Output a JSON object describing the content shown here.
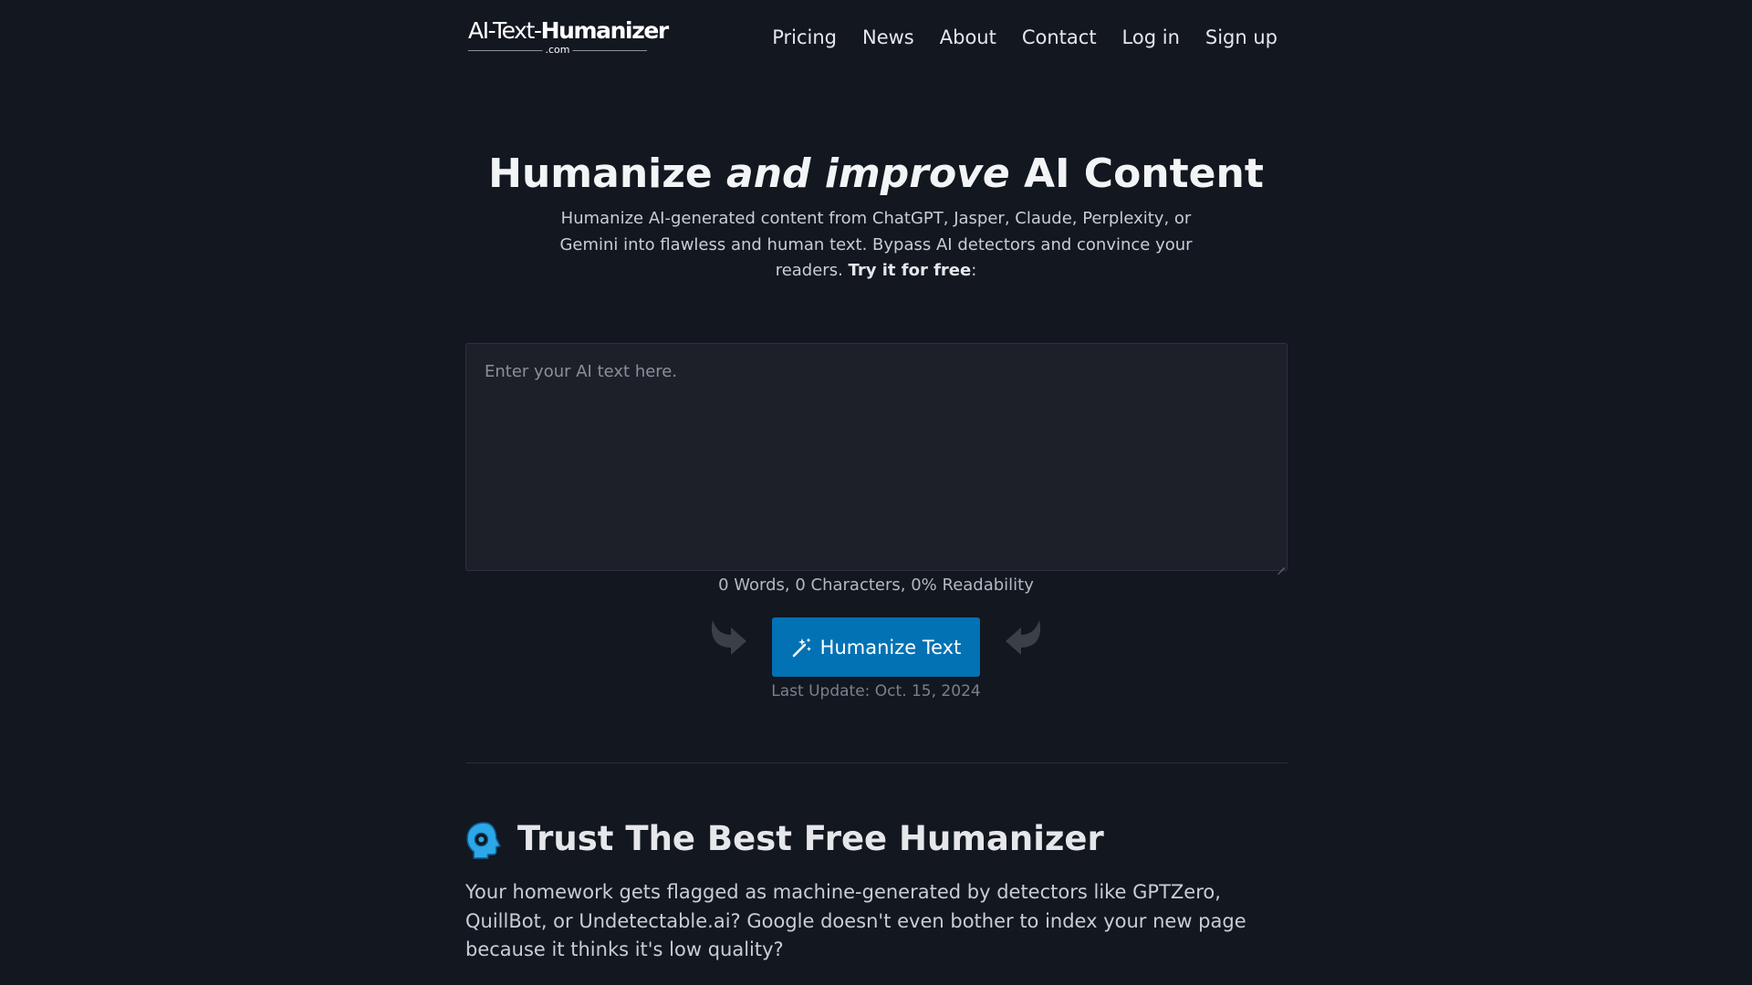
{
  "header": {
    "logo": {
      "part1": "AI-Text-",
      "part2": "Humanizer",
      "sub": ".com"
    },
    "nav": [
      "Pricing",
      "News",
      "About",
      "Contact",
      "Log in",
      "Sign up"
    ]
  },
  "hero": {
    "title_pre": "Humanize ",
    "title_em": "and improve",
    "title_post": " AI Content",
    "subtitle": "Humanize AI-generated content from ChatGPT, Jasper, Claude, Perplexity, or Gemini into flawless and human text. Bypass AI detectors and convince your readers. ",
    "subtitle_bold": "Try it for free",
    "subtitle_end": ":"
  },
  "editor": {
    "placeholder": "Enter your AI text here.",
    "value": "",
    "stats": "0 Words, 0 Characters, 0% Readability"
  },
  "action": {
    "button_label": "Humanize Text",
    "button_icon": "magic-wand-icon",
    "left_arrow_icon": "curved-arrow-right-icon",
    "right_arrow_icon": "curved-arrow-left-icon",
    "last_update": "Last Update: Oct. 15, 2024"
  },
  "trust": {
    "icon": "human-head-icon",
    "title": "Trust The Best Free Humanizer",
    "text": "Your homework gets flagged as machine-generated by detectors like GPTZero, QuillBot, or Undetectable.ai? Google doesn't even bother to index your new page because it thinks it's low quality?"
  },
  "colors": {
    "background": "#131720",
    "editor_bg": "#1e2029",
    "button": "#0272b4",
    "accent_icon": "#2ca7e8"
  }
}
